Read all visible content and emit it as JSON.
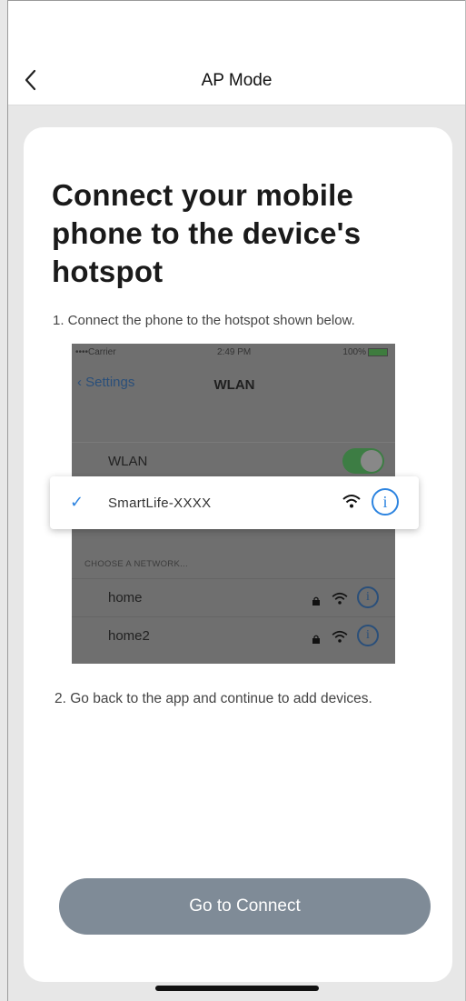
{
  "nav": {
    "title": "AP Mode"
  },
  "card": {
    "heading": "Connect your mobile phone to the device's hotspot",
    "step1": "1. Connect the phone to the hotspot shown below.",
    "step2": "2. Go back to the app and continue to add devices."
  },
  "illustration": {
    "status": {
      "carrier": "••••Carrier",
      "time": "2:49 PM",
      "battery": "100%"
    },
    "back_label": "Settings",
    "title": "WLAN",
    "wlan_label": "WLAN",
    "selected_ssid": "SmartLife-XXXX",
    "choose_header": "CHOOSE A NETWORK...",
    "networks": [
      "home",
      "home2"
    ]
  },
  "button": {
    "label": "Go to Connect"
  },
  "colors": {
    "accent": "#2d84e0",
    "button": "#7f8b97"
  }
}
